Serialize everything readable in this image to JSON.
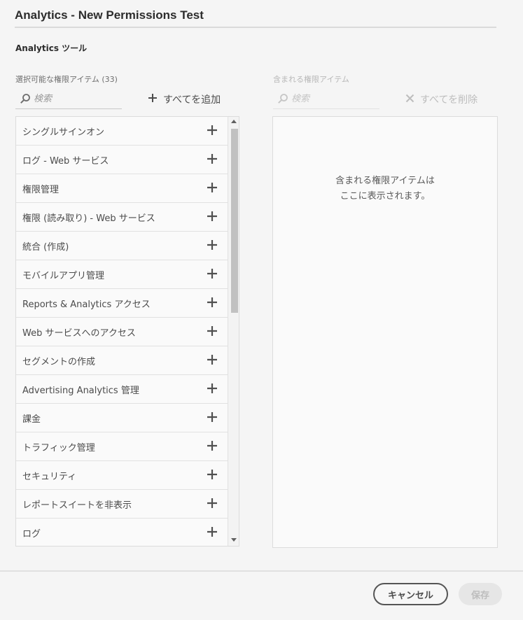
{
  "dialog": {
    "title": "Analytics - New Permissions Test"
  },
  "section": {
    "title": "Analytics ツール"
  },
  "available": {
    "label": "選択可能な権限アイテム (33)",
    "search_placeholder": "検索",
    "add_all_label": "すべてを追加",
    "items": [
      "シングルサインオン",
      "ログ - Web サービス",
      "権限管理",
      "権限 (読み取り) - Web サービス",
      "統合 (作成)",
      "モバイルアプリ管理",
      "Reports & Analytics アクセス",
      "Web サービスへのアクセス",
      "セグメントの作成",
      "Advertising Analytics 管理",
      "課金",
      "トラフィック管理",
      "セキュリティ",
      "レポートスイートを非表示",
      "ログ"
    ]
  },
  "included": {
    "label": "含まれる権限アイテム",
    "search_placeholder": "検索",
    "remove_all_label": "すべてを削除",
    "empty_line1": "含まれる権限アイテムは",
    "empty_line2": "ここに表示されます。"
  },
  "footer": {
    "cancel_label": "キャンセル",
    "save_label": "保存"
  },
  "colors": {
    "text": "#4b4b4b",
    "disabled": "#bdbdbd",
    "border": "#dcdcdc",
    "background": "#f5f5f5"
  },
  "icons": {
    "search": "magnifier-icon",
    "add": "plus-icon",
    "remove": "close-icon"
  }
}
